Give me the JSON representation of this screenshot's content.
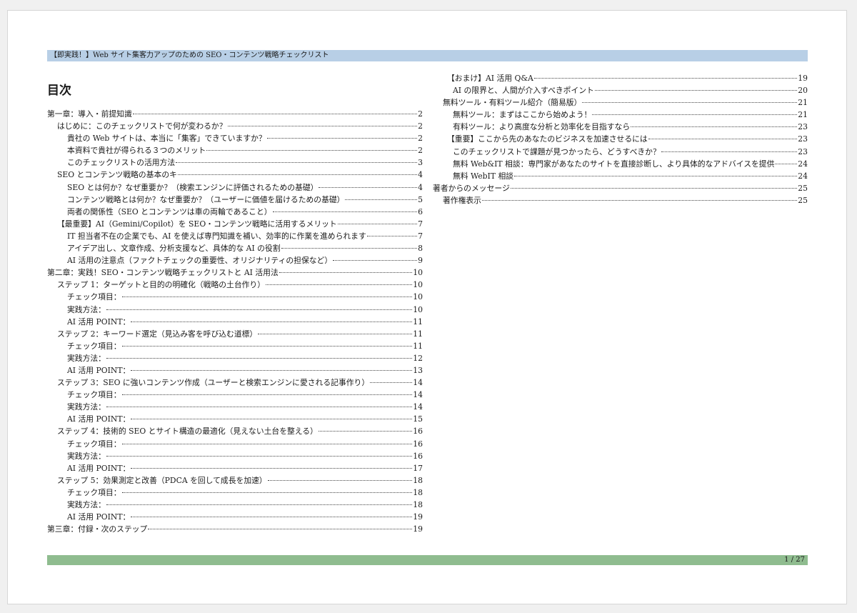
{
  "header": {
    "title": "【即実践！】Web サイト集客力アップのための SEO・コンテンツ戦略チェックリスト"
  },
  "toc": {
    "title": "目次",
    "left": [
      {
        "level": 0,
        "text": "第一章：導入・前提知識",
        "page": "2"
      },
      {
        "level": 1,
        "text": "はじめに：このチェックリストで何が変わるか？",
        "page": "2"
      },
      {
        "level": 2,
        "text": "貴社の Web サイトは、本当に「集客」できていますか？",
        "page": "2"
      },
      {
        "level": 2,
        "text": "本資料で貴社が得られる３つのメリット",
        "page": "2"
      },
      {
        "level": 2,
        "text": "このチェックリストの活用方法",
        "page": "3"
      },
      {
        "level": 1,
        "text": "SEO とコンテンツ戦略の基本のキ",
        "page": "4"
      },
      {
        "level": 2,
        "text": "SEO とは何か？なぜ重要か？（検索エンジンに評価されるための基礎）",
        "page": "4"
      },
      {
        "level": 2,
        "text": "コンテンツ戦略とは何か？なぜ重要か？（ユーザーに価値を届けるための基礎）",
        "page": "5"
      },
      {
        "level": 2,
        "text": "両者の関係性（SEO とコンテンツは車の両輪であること）",
        "page": "6"
      },
      {
        "level": 1,
        "text": "【最重要】AI（Gemini/Copilot）を SEO・コンテンツ戦略に活用するメリット",
        "page": "7"
      },
      {
        "level": 2,
        "text": "IT 担当者不在の企業でも、AI を使えば専門知識を補い、効率的に作業を進められます",
        "page": "7"
      },
      {
        "level": 2,
        "text": "アイデア出し、文章作成、分析支援など、具体的な AI の役割",
        "page": "8"
      },
      {
        "level": 2,
        "text": "AI 活用の注意点（ファクトチェックの重要性、オリジナリティの担保など）",
        "page": "9"
      },
      {
        "level": 0,
        "text": "第二章：実践！SEO・コンテンツ戦略チェックリストと AI 活用法",
        "page": "10"
      },
      {
        "level": 1,
        "text": "ステップ 1：ターゲットと目的の明確化（戦略の土台作り）",
        "page": "10"
      },
      {
        "level": 2,
        "text": "チェック項目：",
        "page": "10"
      },
      {
        "level": 2,
        "text": "実践方法：",
        "page": "10"
      },
      {
        "level": 2,
        "text": "AI 活用 POINT：",
        "page": "11"
      },
      {
        "level": 1,
        "text": "ステップ 2：キーワード選定（見込み客を呼び込む道標）",
        "page": "11"
      },
      {
        "level": 2,
        "text": "チェック項目：",
        "page": "11"
      },
      {
        "level": 2,
        "text": "実践方法：",
        "page": "12"
      },
      {
        "level": 2,
        "text": "AI 活用 POINT：",
        "page": "13"
      },
      {
        "level": 1,
        "text": "ステップ 3：SEO に強いコンテンツ作成（ユーザーと検索エンジンに愛される記事作り）",
        "page": "14"
      },
      {
        "level": 2,
        "text": "チェック項目：",
        "page": "14"
      },
      {
        "level": 2,
        "text": "実践方法：",
        "page": "14"
      },
      {
        "level": 2,
        "text": "AI 活用 POINT：",
        "page": "15"
      },
      {
        "level": 1,
        "text": "ステップ 4：技術的 SEO とサイト構造の最適化（見えない土台を整える）",
        "page": "16"
      },
      {
        "level": 2,
        "text": "チェック項目：",
        "page": "16"
      },
      {
        "level": 2,
        "text": "実践方法：",
        "page": "16"
      },
      {
        "level": 2,
        "text": "AI 活用 POINT：",
        "page": "17"
      },
      {
        "level": 1,
        "text": "ステップ 5：効果測定と改善（PDCA を回して成長を加速）",
        "page": "18"
      },
      {
        "level": 2,
        "text": "チェック項目：",
        "page": "18"
      },
      {
        "level": 2,
        "text": "実践方法：",
        "page": "18"
      },
      {
        "level": 2,
        "text": "AI 活用 POINT：",
        "page": "19"
      },
      {
        "level": 0,
        "text": "第三章：付録・次のステップ",
        "page": "19"
      }
    ],
    "right": [
      {
        "level": 2,
        "text": "【おまけ】AI 活用 Q&A",
        "page": "19"
      },
      {
        "level": 3,
        "text": "AI の限界と、人間が介入すべきポイント",
        "page": "20"
      },
      {
        "level": 1,
        "text": "無料ツール・有料ツール紹介（簡易版）",
        "page": "21"
      },
      {
        "level": 3,
        "text": "無料ツール：まずはここから始めよう！",
        "page": "21"
      },
      {
        "level": 3,
        "text": "有料ツール：より高度な分析と効率化を目指すなら",
        "page": "23"
      },
      {
        "level": 2,
        "text": "【重要】ここから先のあなたのビジネスを加速させるには",
        "page": "23"
      },
      {
        "level": 3,
        "text": "このチェックリストで課題が見つかったら、どうすべきか？",
        "page": "23"
      },
      {
        "level": 3,
        "text": "無料 Web&IT 相談：専門家があなたのサイトを直接診断し、より具体的なアドバイスを提供",
        "page": "24"
      },
      {
        "level": 3,
        "text": "無料 WebIT 相談",
        "page": "24"
      },
      {
        "level": 0,
        "text": "著者からのメッセージ",
        "page": "25"
      },
      {
        "level": 1,
        "text": "著作権表示",
        "page": "25"
      }
    ]
  },
  "footer": {
    "page_indicator": "1 / 27"
  }
}
